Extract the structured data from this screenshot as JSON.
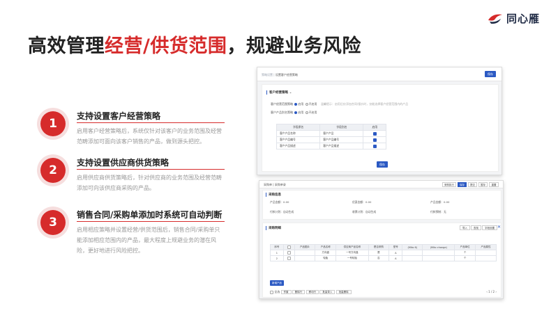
{
  "brand": {
    "name": "同心雁"
  },
  "title": {
    "part1": "高效管理",
    "highlight": "经营/供货范围",
    "part2": "，规避业务风险"
  },
  "features": [
    {
      "number": "1",
      "title": "支持设置客户经营策略",
      "desc": "启用客户经营策略后，系统仅针对该客户的业务范围及经营范畴添加可面向该客户销售的产品，做到源头把控。"
    },
    {
      "number": "2",
      "title": "支持设置供应商供货策略",
      "desc": "启用供应商供货策略后，针对供应商的业务范围及经营范畴添加可向该供应商采购的产品。"
    },
    {
      "number": "3",
      "title": "销售合同/采购单添加时系统可自动判断",
      "desc": "启用相应策略并设置经营/供货范围后，销售合同/采购单只能添加相应范围内的产品，最大程度上规避业务的潜在风险，更好地进行风险把控。"
    }
  ],
  "panel1": {
    "breadcrumb_muted": "策略设置 |",
    "breadcrumb": "设置客户经营策略",
    "save": "保存",
    "section": "客户经营策略",
    "row1_label": "客户经营范围策略",
    "row2_label": "客户产品别名策略",
    "opt_on": "启用",
    "opt_off": "不启用",
    "hint": "温馨提示：启用后仅添加合同/报价时，仅能选择客户经营范围内的产品",
    "table_headers": [
      "字段原名",
      "字段别名",
      "启用"
    ],
    "table_rows": [
      [
        "客户产品名称",
        "客户产品"
      ],
      [
        "客户产品编号",
        "客户产品编号"
      ],
      [
        "客户产品描述",
        "客户产品描述"
      ]
    ],
    "save_bottom": "保存"
  },
  "panel2": {
    "breadcrumb": "采购单 | 采购单录",
    "toolbar": [
      "采购执行",
      "保存",
      "提交",
      "暂存",
      "重置"
    ],
    "section1": "采购信息",
    "fields": [
      {
        "label": "产品金额：",
        "value": "0.00"
      },
      {
        "label": "优惠金额：",
        "value": "0.00"
      },
      {
        "label": "产品金额：",
        "value": "0.00"
      },
      {
        "label": "付款计划：",
        "value": "自动生成"
      },
      {
        "label": "收票计划：",
        "value": "自动生成"
      },
      {
        "label": "付款预制：",
        "value": "无"
      }
    ],
    "section2": "采购明细",
    "buttons": [
      "导入",
      "查找",
      "字段设置"
    ],
    "headers": [
      "序号",
      "",
      "产品图片",
      "产品名称",
      "供应商产品名称",
      "是否采购",
      "型号",
      "(Mito 6)",
      "(Mito change)",
      "产品单位",
      "产品属性"
    ],
    "rows": [
      [
        "1",
        "",
        "",
        "方向盘",
        "一号方向盘",
        "是",
        "A",
        "",
        "",
        "个",
        ""
      ],
      [
        "2",
        "",
        "",
        "轮胎",
        "一号轮胎",
        "否",
        "A",
        "",
        "",
        "个",
        ""
      ]
    ],
    "add_button": "新增产品",
    "footer_left": [
      "全选",
      "作废",
      "删除行",
      "移动行",
      "批量录入",
      "批量删除"
    ],
    "footer_right": "1 / 2"
  },
  "colors": {
    "accent": "#d62b2b",
    "blue": "#2b59c3"
  }
}
